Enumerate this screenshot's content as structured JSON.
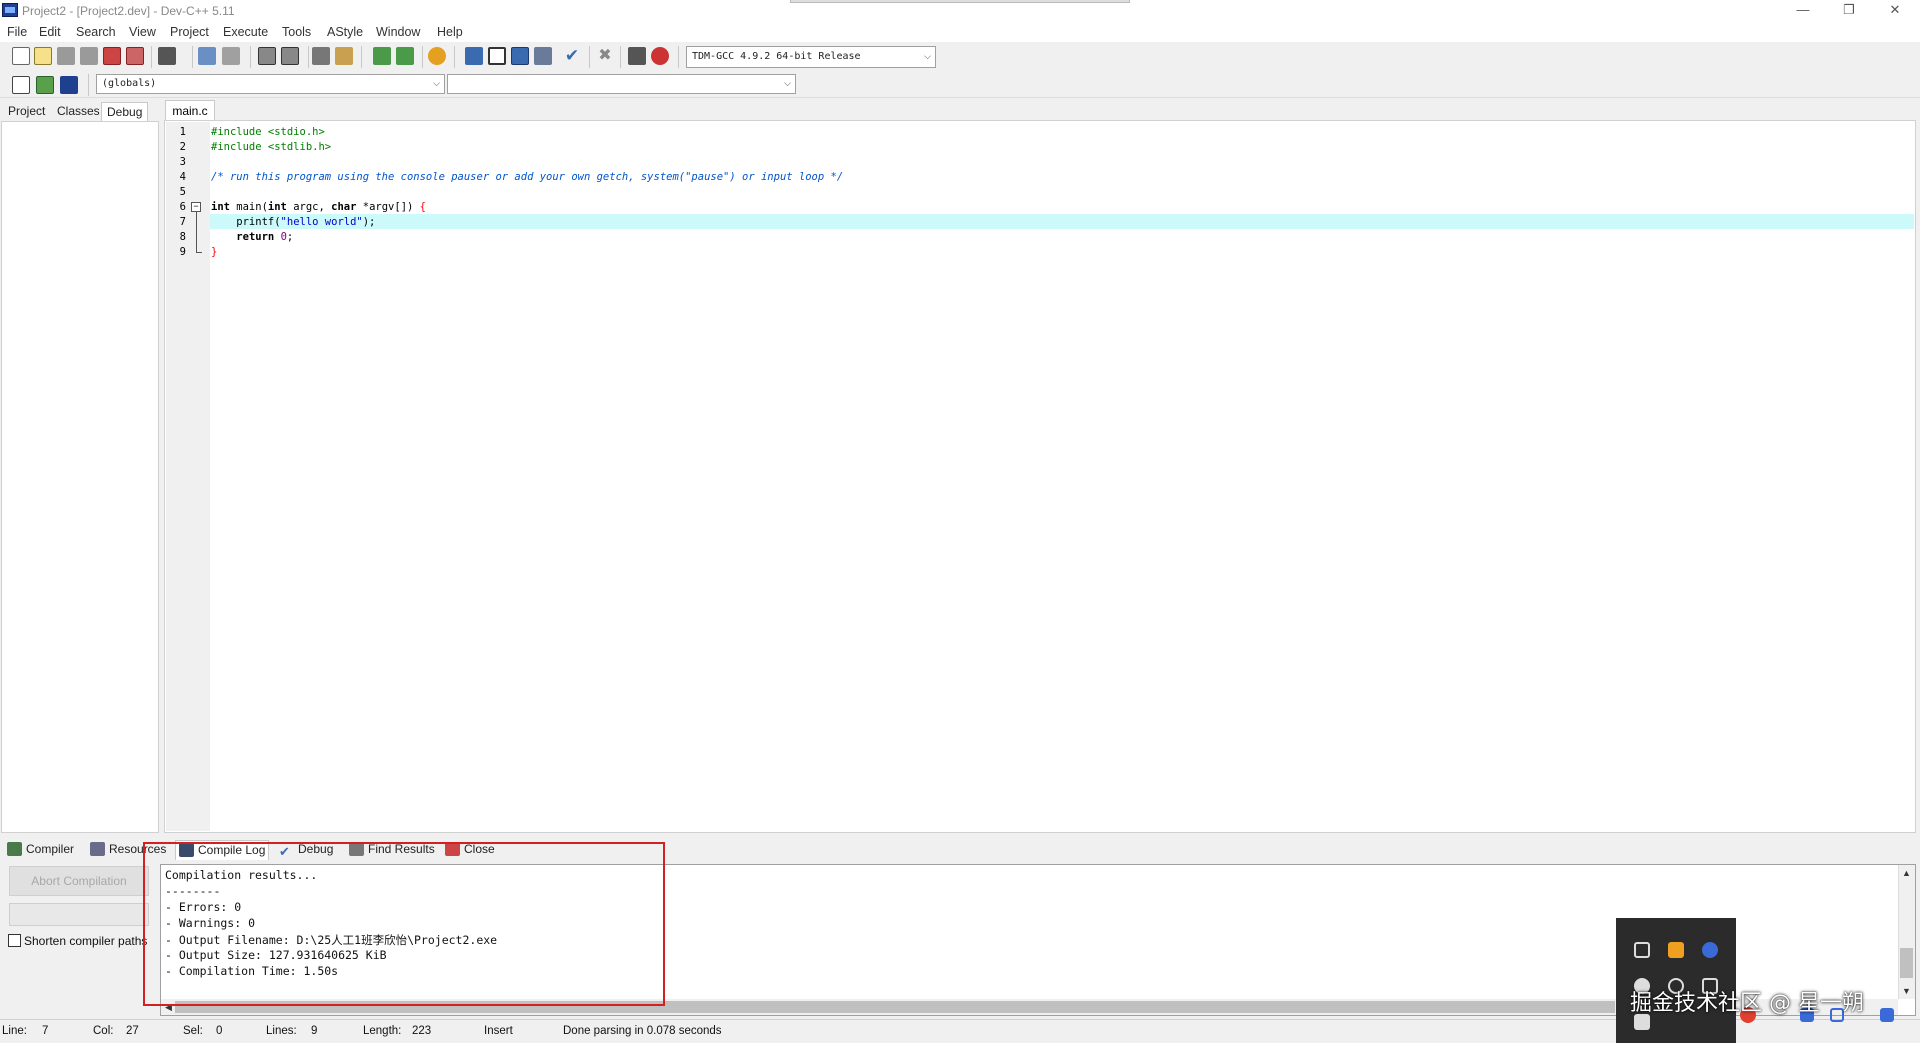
{
  "window": {
    "title": "Project2 - [Project2.dev] - Dev-C++ 5.11",
    "minimize": "—",
    "restore": "❐",
    "close": "✕"
  },
  "menu": [
    "File",
    "Edit",
    "Search",
    "View",
    "Project",
    "Execute",
    "Tools",
    "AStyle",
    "Window",
    "Help"
  ],
  "toolbar": {
    "compiler_select": "TDM-GCC 4.9.2 64-bit Release",
    "scope_select": "(globals)",
    "member_select": ""
  },
  "left_tabs": [
    "Project",
    "Classes",
    "Debug"
  ],
  "editor": {
    "tab": "main.c",
    "line_numbers": [
      "1",
      "2",
      "3",
      "4",
      "5",
      "6",
      "7",
      "8",
      "9"
    ]
  },
  "bottom_tabs": {
    "compiler": "Compiler",
    "resources": "Resources",
    "compile_log": "Compile Log",
    "debug": "Debug",
    "find_results": "Find Results",
    "close": "Close"
  },
  "compile_panel": {
    "abort_button": "Abort Compilation",
    "shorten_label": "Shorten compiler paths",
    "log": [
      "Compilation results...",
      "--------",
      "- Errors: 0",
      "- Warnings: 0",
      "- Output Filename: D:\\25人工1班李欣怡\\Project2.exe",
      "- Output Size: 127.931640625 KiB",
      "- Compilation Time: 1.50s"
    ]
  },
  "status": {
    "line_label": "Line:",
    "line": "7",
    "col_label": "Col:",
    "col": "27",
    "sel_label": "Sel:",
    "sel": "0",
    "lines_label": "Lines:",
    "lines": "9",
    "length_label": "Length:",
    "length": "223",
    "mode": "Insert",
    "message": "Done parsing in 0.078 seconds"
  },
  "watermark": "掘金技术社区 @ 星一朔",
  "icons": {
    "accent_blue": "#1f3f8f",
    "highlight_red": "#d42020",
    "current_line": "#ccfafa"
  }
}
